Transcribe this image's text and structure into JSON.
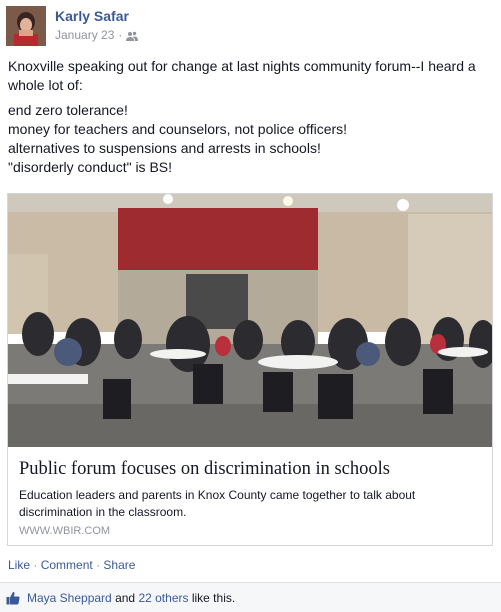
{
  "post": {
    "author": "Karly Safar",
    "date": "January 23",
    "audience_icon": "friends-icon",
    "message_lead": "Knoxville speaking out for change at last nights community forum--I heard a whole lot of:",
    "message_lines": [
      "end zero tolerance!",
      "money for teachers and counselors, not police officers!",
      "alternatives to suspensions and arrests in schools!",
      "\"disorderly conduct\" is BS!"
    ]
  },
  "link": {
    "title": "Public forum focuses on discrimination in schools",
    "description": "Education leaders and parents in Knox County came together to talk about discrimination in the classroom.",
    "domain": "WWW.WBIR.COM"
  },
  "actions": {
    "like": "Like",
    "comment": "Comment",
    "share": "Share",
    "separator": "·"
  },
  "likes": {
    "first_name": "Maya Sheppard",
    "and_text": "and",
    "others": "22 others",
    "suffix": "like this."
  },
  "colors": {
    "link_blue": "#3b5998",
    "meta_gray": "#90949c"
  }
}
